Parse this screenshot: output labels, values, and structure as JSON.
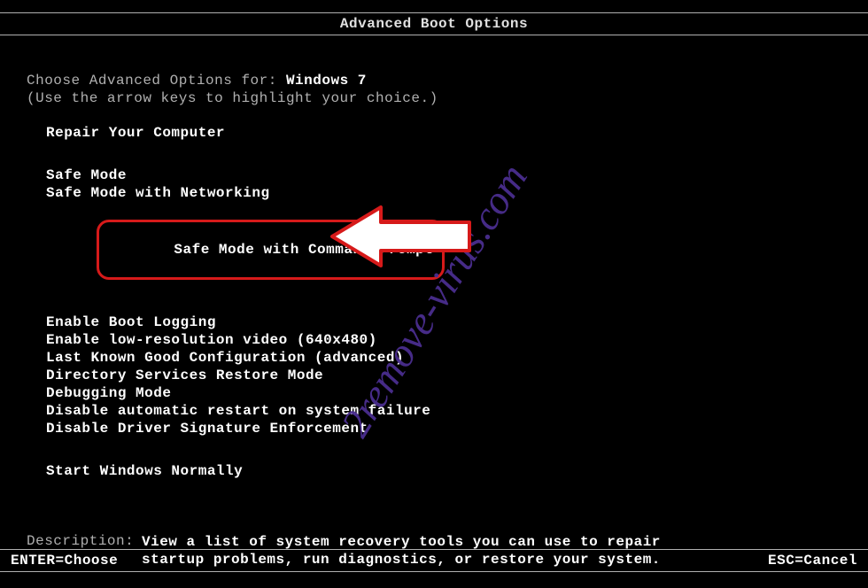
{
  "title": "Advanced Boot Options",
  "choose_prefix": "Choose Advanced Options for: ",
  "os_name": "Windows 7",
  "hint": "(Use the arrow keys to highlight your choice.)",
  "options": {
    "repair": "Repair Your Computer",
    "safe_mode": "Safe Mode",
    "safe_mode_net": "Safe Mode with Networking",
    "safe_mode_cmd": "Safe Mode with Command Prompt",
    "boot_logging": "Enable Boot Logging",
    "low_res": "Enable low-resolution video (640x480)",
    "last_known": "Last Known Good Configuration (advanced)",
    "ds_restore": "Directory Services Restore Mode",
    "debugging": "Debugging Mode",
    "disable_restart": "Disable automatic restart on system failure",
    "disable_driver_sig": "Disable Driver Signature Enforcement",
    "start_normal": "Start Windows Normally"
  },
  "description": {
    "label": "Description:",
    "line1": "View a list of system recovery tools you can use to repair",
    "line2": "startup problems, run diagnostics, or restore your system."
  },
  "footer": {
    "enter": "ENTER=Choose",
    "esc": "ESC=Cancel"
  },
  "watermark": "2remove-virus.com"
}
